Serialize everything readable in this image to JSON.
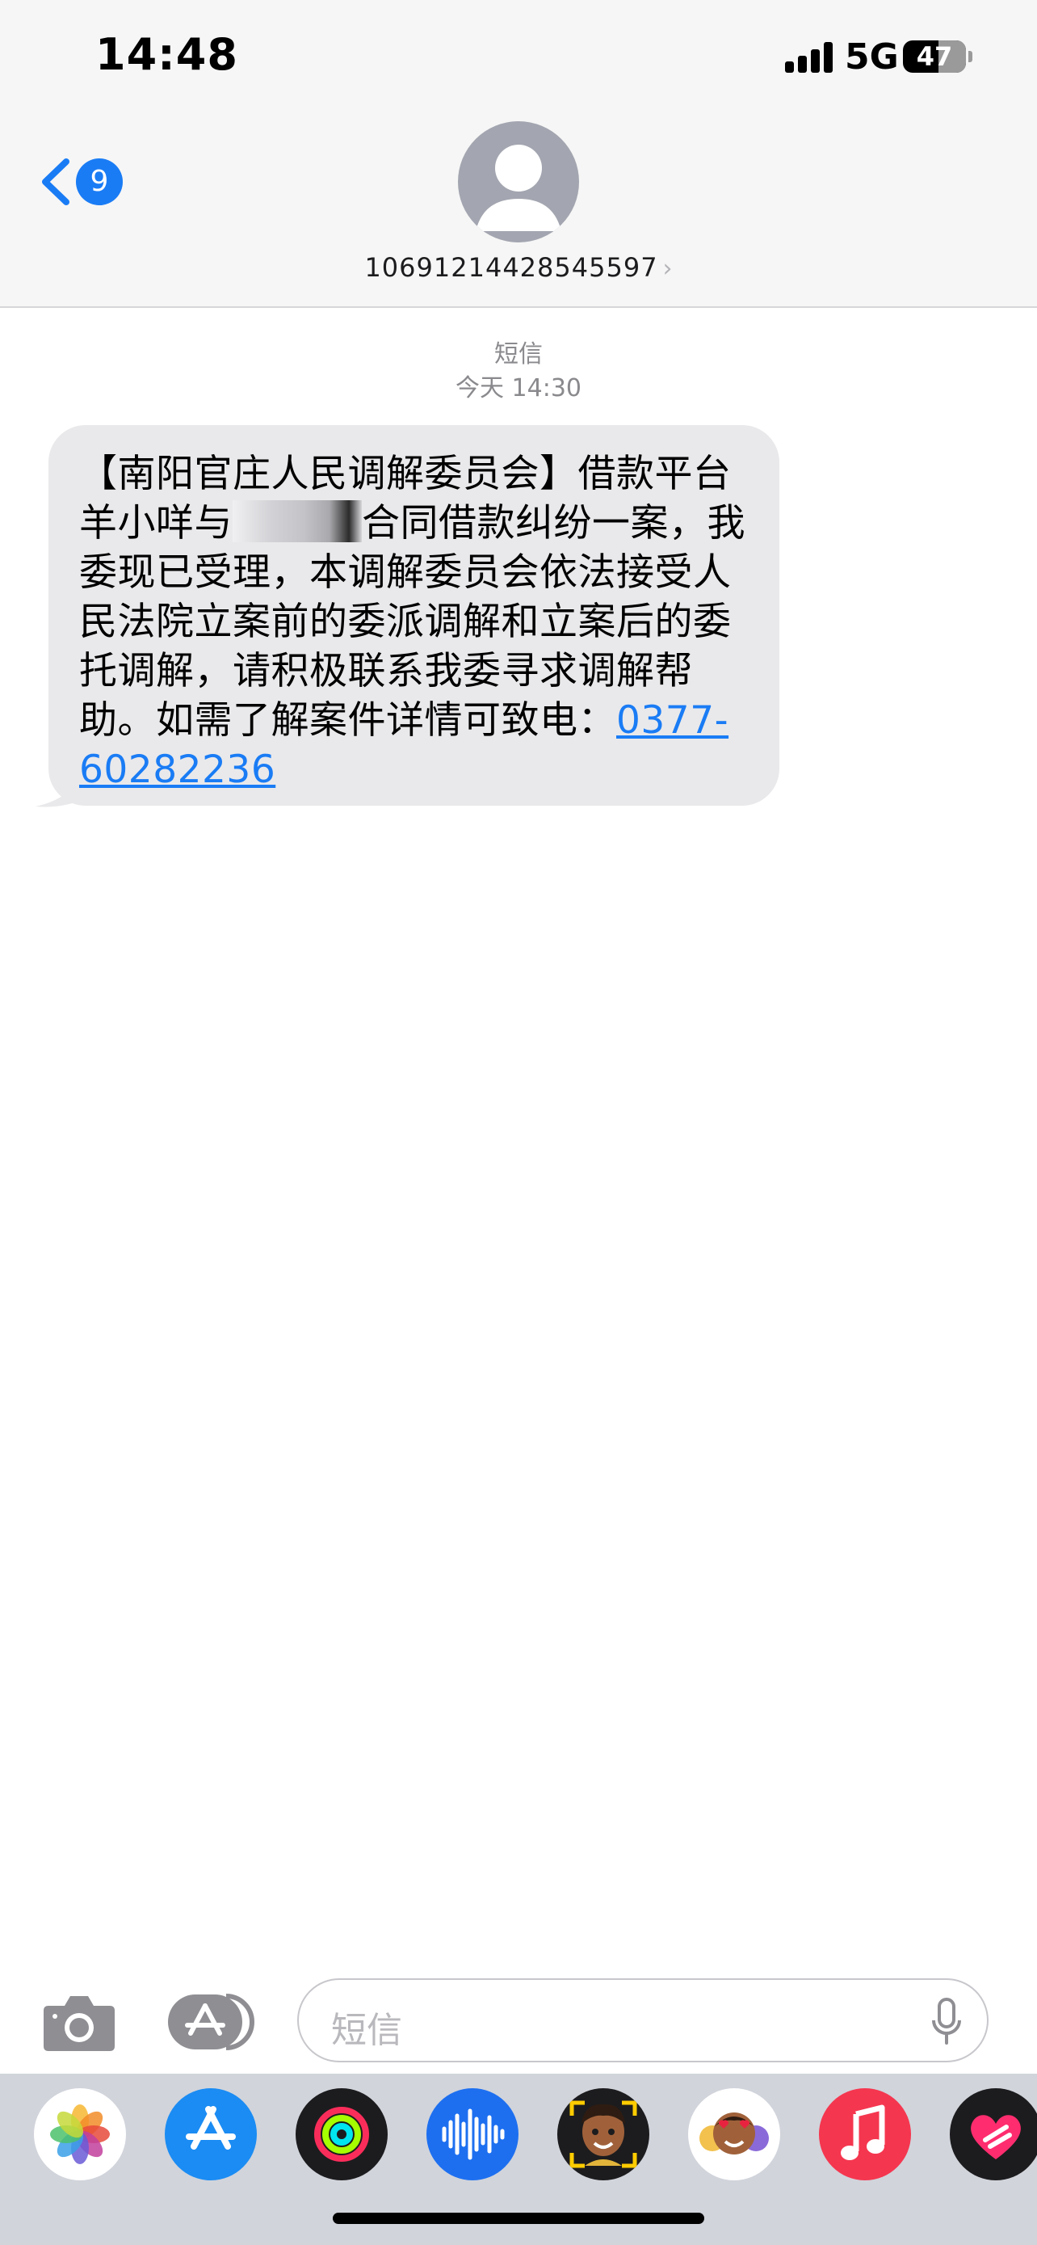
{
  "status_bar": {
    "time": "14:48",
    "network": "5G",
    "battery": "47",
    "battery_level": 0.47
  },
  "nav": {
    "back_badge": "9",
    "contact": "10691214428545597",
    "contact_chevron": "›",
    "avatar_icon": "person-silhouette-icon"
  },
  "conversation": {
    "service": "短信",
    "timestamp": "今天 14:30",
    "message": {
      "part1": "【南阳官庄人民调解委员会】借款平台羊小咩与",
      "part2": "合同借款纠纷一案，我委现已受理，本调解委员会依法接受人民法院立案前的委派调解和立案后的委托调解，请积极联系我委寻求调解帮助。如需了解案件详情可致电：",
      "phone": "0377-60282236"
    }
  },
  "input": {
    "placeholder": "短信"
  },
  "colors": {
    "accent": "#1a7cf5",
    "bubble": "#e9e9eb",
    "header_bg": "#f6f6f6",
    "drawer_bg": "#d1d4db"
  },
  "app_drawer": [
    {
      "icon": "photos-icon"
    },
    {
      "icon": "app-store-icon"
    },
    {
      "icon": "activity-icon"
    },
    {
      "icon": "audio-message-icon"
    },
    {
      "icon": "memoji-icon"
    },
    {
      "icon": "memoji-stickers-icon"
    },
    {
      "icon": "music-icon"
    },
    {
      "icon": "digital-touch-icon"
    }
  ]
}
